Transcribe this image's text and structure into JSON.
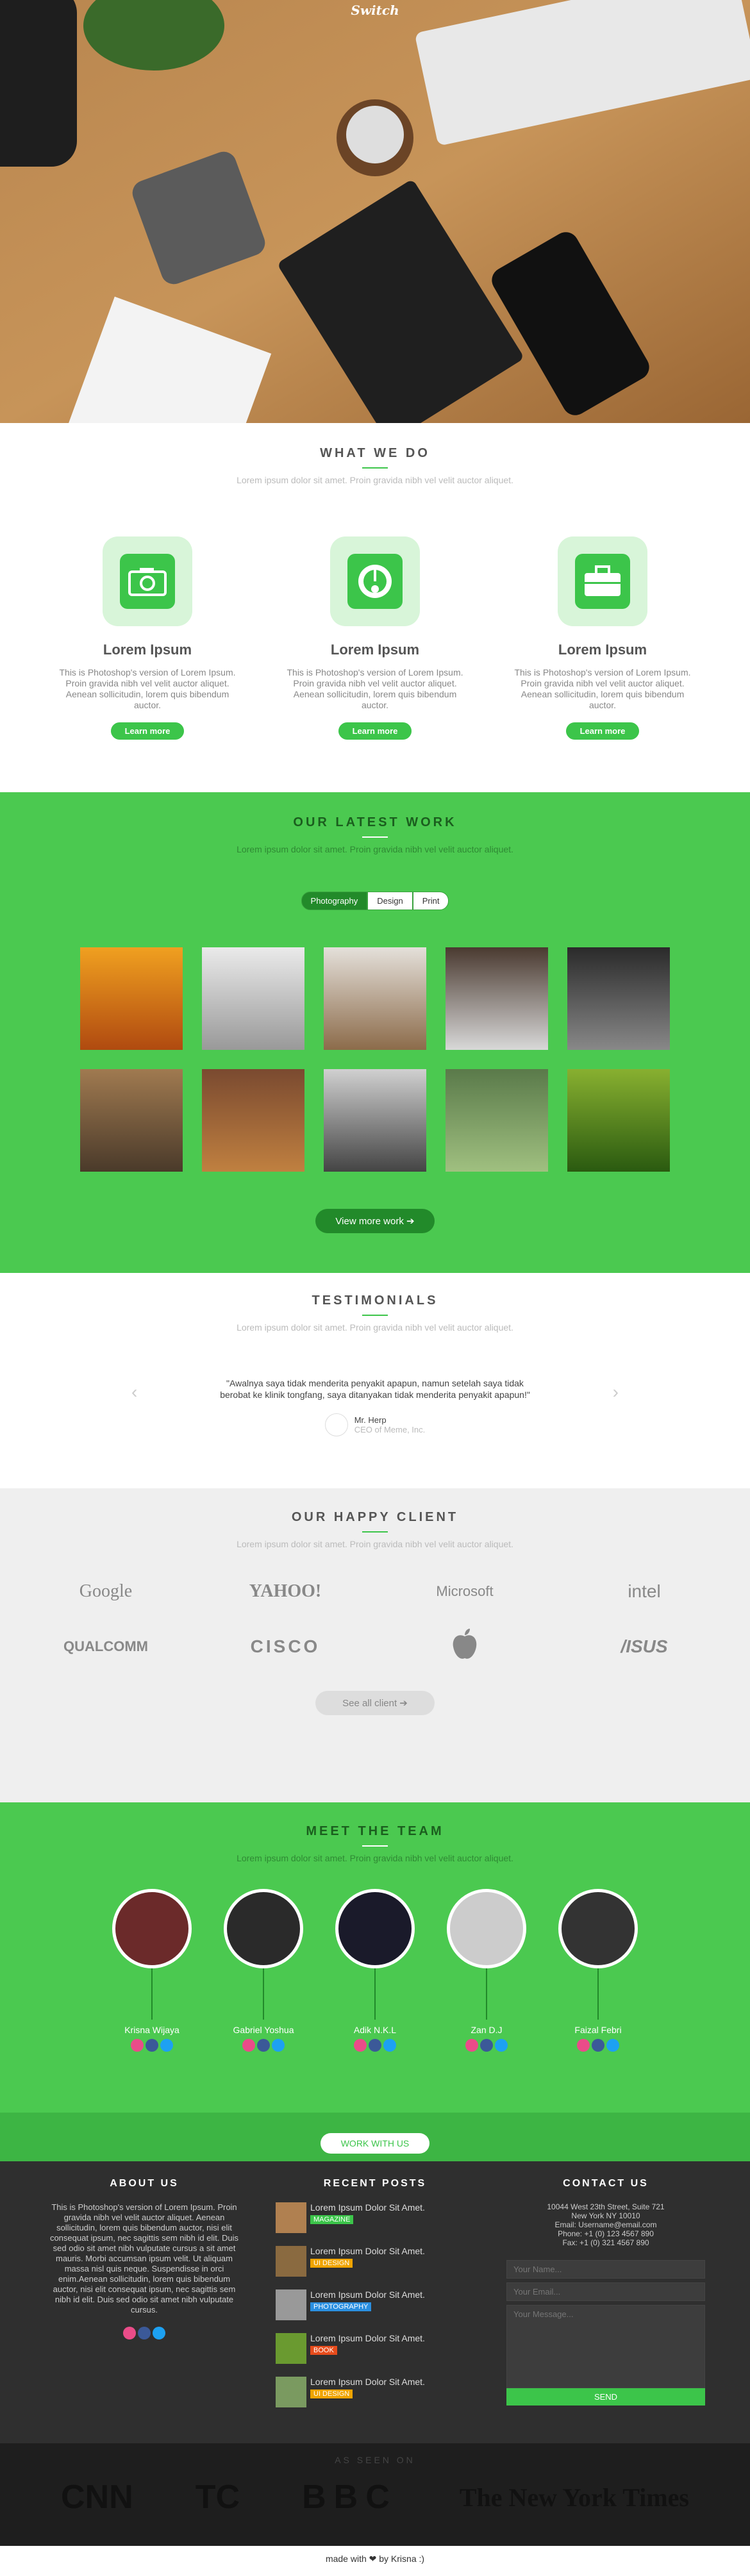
{
  "hero": {
    "brand": "Switch"
  },
  "what": {
    "title": "WHAT WE DO",
    "subtitle": "Lorem ipsum dolor sit amet. Proin gravida nibh vel velit auctor aliquet.",
    "services": [
      {
        "icon": "camera-icon",
        "title": "Lorem Ipsum",
        "text": "This is Photoshop's version  of Lorem Ipsum. Proin gravida nibh vel velit auctor aliquet. Aenean sollicitudin, lorem quis bibendum auctor.",
        "button": "Learn more"
      },
      {
        "icon": "dashboard-icon",
        "title": "Lorem Ipsum",
        "text": "This is Photoshop's version  of Lorem Ipsum. Proin gravida nibh vel velit auctor aliquet. Aenean sollicitudin, lorem quis bibendum auctor.",
        "button": "Learn more"
      },
      {
        "icon": "briefcase-icon",
        "title": "Lorem Ipsum",
        "text": "This is Photoshop's version  of Lorem Ipsum. Proin gravida nibh vel velit auctor aliquet. Aenean sollicitudin, lorem quis bibendum auctor.",
        "button": "Learn more"
      }
    ]
  },
  "work": {
    "title": "OUR LATEST WORK",
    "subtitle": "Lorem ipsum dolor sit amet. Proin gravida nibh vel velit auctor aliquet.",
    "filters": [
      "Photography",
      "Design",
      "Print"
    ],
    "active_filter": "Photography",
    "button": "View more work ➔"
  },
  "testimonials": {
    "title": "TESTIMONIALS",
    "subtitle": "Lorem ipsum dolor sit amet. Proin gravida nibh vel velit auctor aliquet.",
    "quote": "\"Awalnya saya tidak menderita penyakit apapun, namun setelah saya tidak berobat ke klinik tongfang, saya ditanyakan tidak menderita penyakit apapun!\"",
    "author": "Mr. Herp",
    "role": "CEO of Meme, Inc."
  },
  "clients": {
    "title": "OUR HAPPY CLIENT",
    "subtitle": "Lorem ipsum dolor sit amet. Proin gravida nibh vel velit auctor aliquet.",
    "logos": [
      "Google",
      "YAHOO!",
      "Microsoft",
      "intel",
      "QUALCOMM",
      "CISCO",
      "",
      "/ISUS"
    ],
    "button": "See all client  ➔"
  },
  "team": {
    "title": "MEET THE TEAM",
    "subtitle": "Lorem ipsum dolor sit amet. Proin gravida nibh vel velit auctor aliquet.",
    "members": [
      "Krisna Wijaya",
      "Gabriel Yoshua",
      "Adik N.K.L",
      "Zan D.J",
      "Faizal Febri"
    ],
    "button": "WORK WITH US"
  },
  "footer": {
    "about_title": "ABOUT US",
    "about_text": "This is Photoshop's version  of Lorem Ipsum. Proin gravida nibh vel velit auctor aliquet. Aenean sollicitudin, lorem quis bibendum auctor, nisi elit consequat ipsum, nec sagittis sem nibh id elit. Duis sed odio sit amet nibh vulputate cursus a sit amet mauris. Morbi accumsan ipsum velit. Ut aliquam massa nisl quis neque. Suspendisse in orci enim.Aenean sollicitudin, lorem quis bibendum auctor, nisi elit consequat ipsum, nec sagittis sem nibh id elit. Duis sed odio sit amet nibh vulputate cursus.",
    "posts_title": "RECENT POSTS",
    "posts": [
      {
        "title": "Lorem Ipsum Dolor Sit Amet.",
        "tag": "MAGAZINE",
        "color": "#3cc54a"
      },
      {
        "title": "Lorem Ipsum Dolor Sit Amet.",
        "tag": "UI DESIGN",
        "color": "#f0a400"
      },
      {
        "title": "Lorem Ipsum Dolor Sit Amet.",
        "tag": "PHOTOGRAPHY",
        "color": "#2a8fe0"
      },
      {
        "title": "Lorem Ipsum Dolor Sit Amet.",
        "tag": "BOOK",
        "color": "#e74c1c"
      },
      {
        "title": "Lorem Ipsum Dolor Sit Amet.",
        "tag": "UI DESIGN",
        "color": "#f0a400"
      }
    ],
    "contact_title": "CONTACT US",
    "address": [
      "10044 West 23th Street, Suite 721",
      "New York NY 10010",
      "Email: Username@email.com",
      "Phone: +1 (0) 123 4567 890",
      "Fax: +1 (0) 321 4567 890"
    ],
    "form": {
      "name": "Your Name...",
      "email": "Your Email...",
      "message": "Your Message...",
      "send": "SEND"
    }
  },
  "seen": {
    "label": "AS SEEN ON",
    "press": [
      "CNN",
      "TC",
      "BBC",
      "The New York Times"
    ]
  },
  "made": {
    "text": "made with ❤ by Krisna :)"
  }
}
